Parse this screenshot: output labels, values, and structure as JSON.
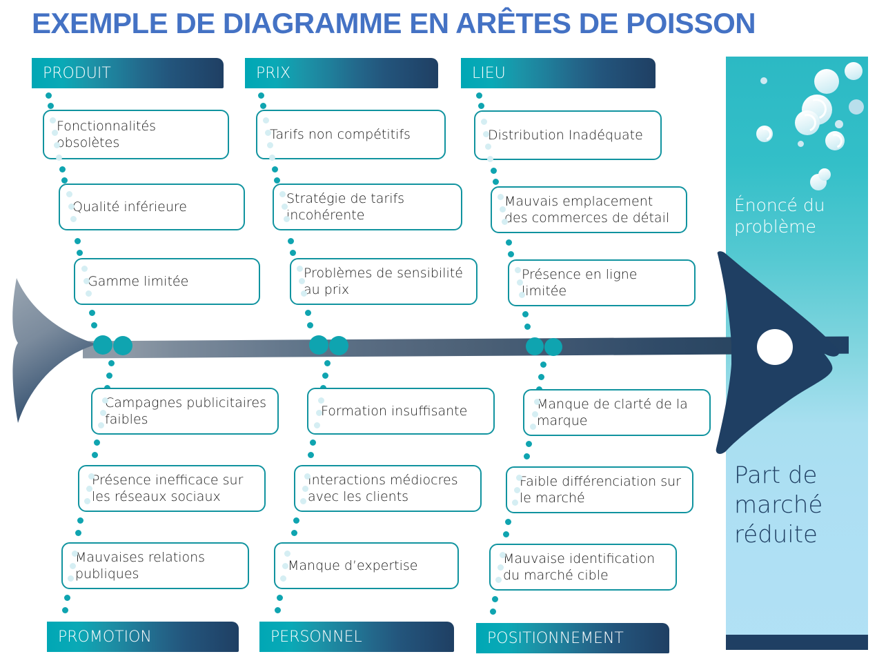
{
  "title": "EXEMPLE DE DIAGRAMME EN ARÊTES DE POISSON",
  "colors": {
    "title": "#4472C4",
    "accent_teal": "#0fa4b0",
    "box_border": "#10939f",
    "spine_dark": "#1f3f63",
    "panel_top": "#2cb9c4",
    "panel_bottom": "#b2e1f5",
    "dot_pale": "#d5eef3"
  },
  "problem_panel": {
    "statement_label": "Énoncé du problème",
    "effect_label": "Part de marché réduite"
  },
  "categories_top": [
    {
      "label": "PRODUIT",
      "causes": [
        "Fonctionnalités obsolètes",
        "Qualité inférieure",
        "Gamme limitée"
      ]
    },
    {
      "label": "PRIX",
      "causes": [
        "Tarifs non compétitifs",
        "Stratégie de tarifs incohérente",
        "Problèmes de sensibilité au prix"
      ]
    },
    {
      "label": "LIEU",
      "causes": [
        "Distribution Inadéquate",
        "Mauvais emplacement des commerces de détail",
        "Présence en ligne limitée"
      ]
    }
  ],
  "categories_bottom": [
    {
      "label": "PROMOTION",
      "causes": [
        "Campagnes publicitaires faibles",
        "Présence inefficace sur les réseaux sociaux",
        "Mauvaises relations publiques"
      ]
    },
    {
      "label": "PERSONNEL",
      "causes": [
        "Formation insuffisante",
        "Interactions médiocres avec les clients",
        "Manque d’expertise"
      ]
    },
    {
      "label": "POSITIONNEMENT",
      "causes": [
        "Manque de clarté de la marque",
        "Faible différenciation sur le marché",
        "Mauvaise identification du marché cible"
      ]
    }
  ]
}
